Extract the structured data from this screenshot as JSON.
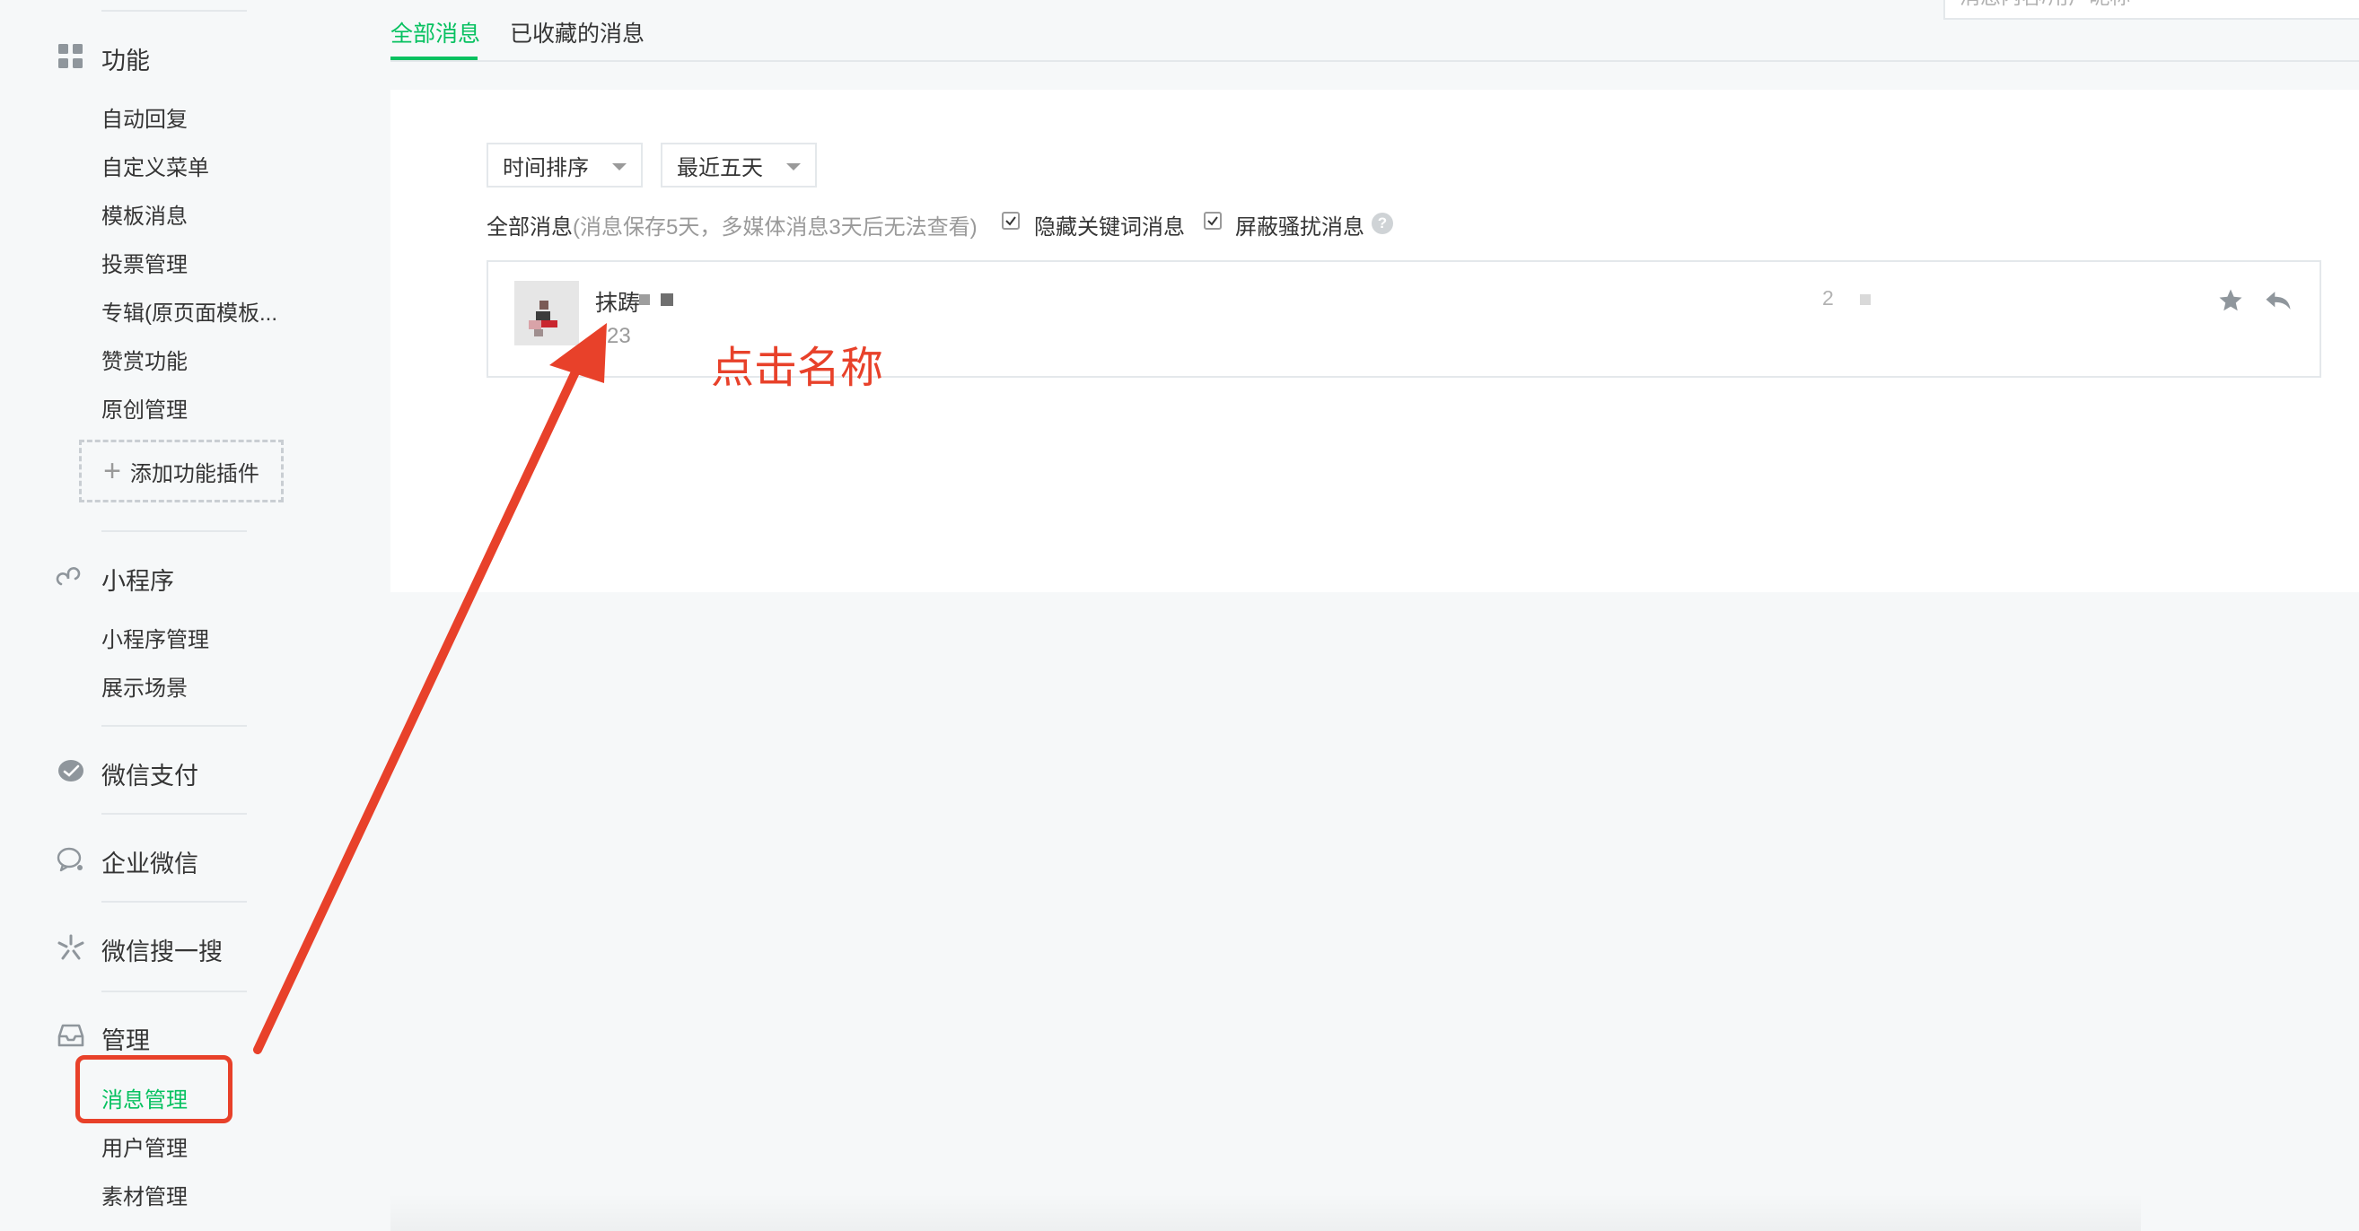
{
  "sidebar": {
    "sections": [
      {
        "title": "功能",
        "icon": "grid-icon",
        "items": [
          "自动回复",
          "自定义菜单",
          "模板消息",
          "投票管理",
          "专辑(原页面模板...",
          "赞赏功能",
          "原创管理"
        ]
      },
      {
        "title": "小程序",
        "icon": "mini-program-icon",
        "items": [
          "小程序管理",
          "展示场景"
        ]
      },
      {
        "title": "微信支付",
        "icon": "wechat-pay-icon",
        "items": []
      },
      {
        "title": "企业微信",
        "icon": "work-wechat-icon",
        "items": []
      },
      {
        "title": "微信搜一搜",
        "icon": "wechat-search-icon",
        "items": []
      },
      {
        "title": "管理",
        "icon": "inbox-icon",
        "items": [
          "消息管理",
          "用户管理",
          "素材管理"
        ]
      }
    ],
    "add_plugin": "添加功能插件",
    "active_item": "消息管理"
  },
  "tabs": {
    "all": "全部消息",
    "starred": "已收藏的消息",
    "active": "全部消息"
  },
  "search": {
    "placeholder": "消息内容/用户昵称"
  },
  "filters": {
    "sort": "时间排序",
    "range": "最近五天",
    "label": "全部消息",
    "note": "(消息保存5天，多媒体消息3天后无法查看)",
    "hide_keyword": {
      "label": "隐藏关键词消息",
      "checked": true
    },
    "block_spam": {
      "label": "屏蔽骚扰消息",
      "checked": true
    },
    "help": "?"
  },
  "message": {
    "name": "抹踌",
    "preview": "23",
    "time": "2"
  },
  "annotation": {
    "text": "点击名称"
  },
  "colors": {
    "accent": "#07c160",
    "annotation": "#e8412a",
    "muted": "#9a9a9a"
  }
}
